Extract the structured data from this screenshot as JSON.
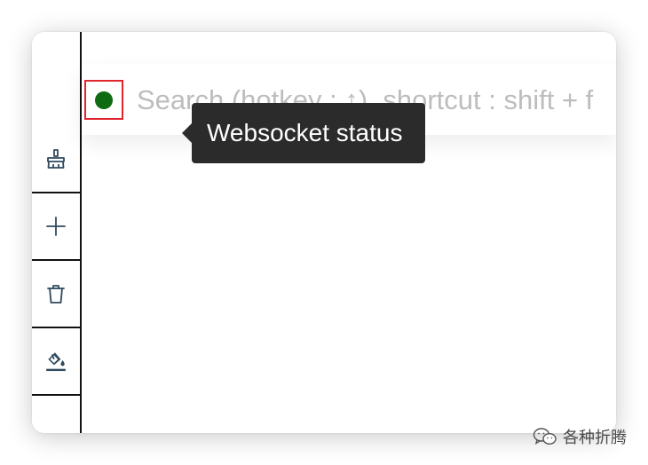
{
  "sidebar": {
    "items": [
      {
        "icon": "broom-icon",
        "name": "clear"
      },
      {
        "icon": "plus-icon",
        "name": "add"
      },
      {
        "icon": "trash-icon",
        "name": "delete"
      },
      {
        "icon": "paint-bucket-icon",
        "name": "format"
      }
    ]
  },
  "search": {
    "placeholder": "Search (hotkey : ↑), shortcut : shift + f"
  },
  "websocket": {
    "status": "connected",
    "status_color": "#0f6b12"
  },
  "tooltip": {
    "text": "Websocket status"
  },
  "watermark": {
    "text": "各种折腾"
  }
}
